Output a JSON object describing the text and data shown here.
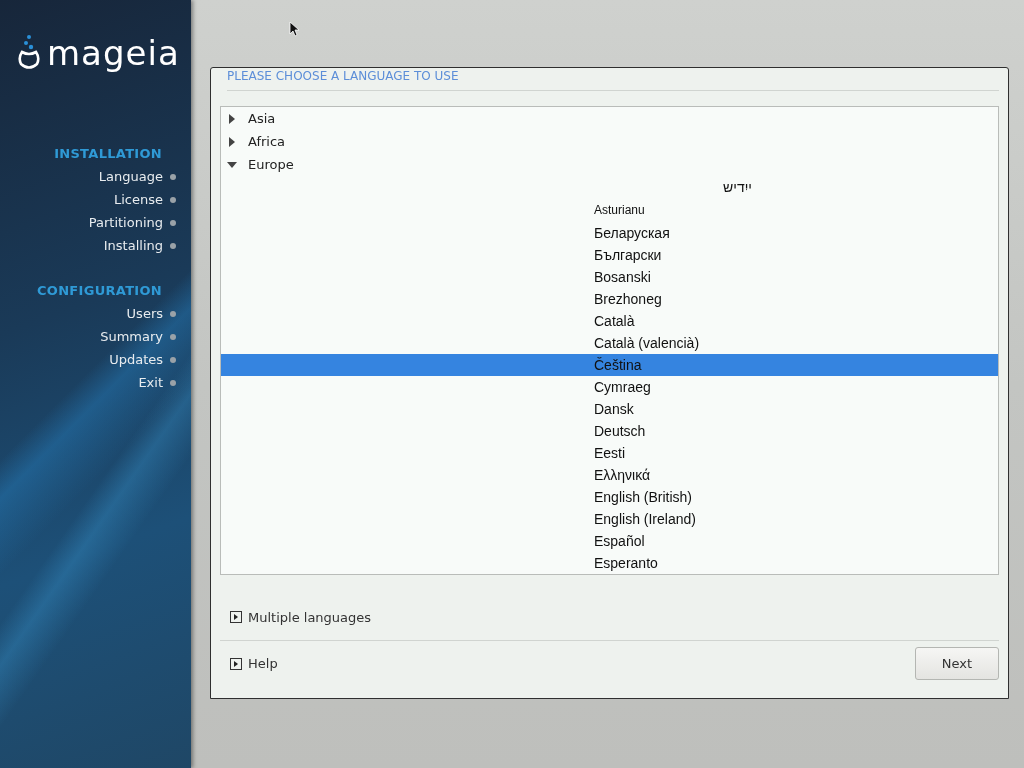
{
  "logo": {
    "text": "mageia"
  },
  "sidebar": {
    "sections": [
      {
        "heading": "INSTALLATION",
        "items": [
          "Language",
          "License",
          "Partitioning",
          "Installing"
        ]
      },
      {
        "heading": "CONFIGURATION",
        "items": [
          "Users",
          "Summary",
          "Updates",
          "Exit"
        ]
      }
    ]
  },
  "panel": {
    "title": "PLEASE CHOOSE A LANGUAGE TO USE",
    "tree": [
      {
        "label": "Asia",
        "expanded": false
      },
      {
        "label": "Africa",
        "expanded": false
      },
      {
        "label": "Europe",
        "expanded": true,
        "children": [
          {
            "label": "ייִדיש",
            "kind": "rtl",
            "selected": false
          },
          {
            "label": "Asturianu",
            "kind": "small",
            "selected": false
          },
          {
            "label": "Беларуская",
            "kind": "normal",
            "selected": false
          },
          {
            "label": "Български",
            "kind": "normal",
            "selected": false
          },
          {
            "label": "Bosanski",
            "kind": "normal",
            "selected": false
          },
          {
            "label": "Brezhoneg",
            "kind": "normal",
            "selected": false
          },
          {
            "label": "Català",
            "kind": "normal",
            "selected": false
          },
          {
            "label": "Català (valencià)",
            "kind": "normal",
            "selected": false
          },
          {
            "label": "Čeština",
            "kind": "normal",
            "selected": true
          },
          {
            "label": "Cymraeg",
            "kind": "normal",
            "selected": false
          },
          {
            "label": "Dansk",
            "kind": "normal",
            "selected": false
          },
          {
            "label": "Deutsch",
            "kind": "normal",
            "selected": false
          },
          {
            "label": "Eesti",
            "kind": "normal",
            "selected": false
          },
          {
            "label": "Ελληνικά",
            "kind": "normal",
            "selected": false
          },
          {
            "label": "English (British)",
            "kind": "normal",
            "selected": false
          },
          {
            "label": "English (Ireland)",
            "kind": "normal",
            "selected": false
          },
          {
            "label": "Español",
            "kind": "normal",
            "selected": false
          },
          {
            "label": "Esperanto",
            "kind": "normal",
            "selected": false
          }
        ]
      }
    ],
    "expanders": [
      {
        "label": "Multiple languages",
        "expanded": false
      }
    ],
    "help": {
      "label": "Help",
      "expanded": false
    },
    "next_button": "Next"
  }
}
